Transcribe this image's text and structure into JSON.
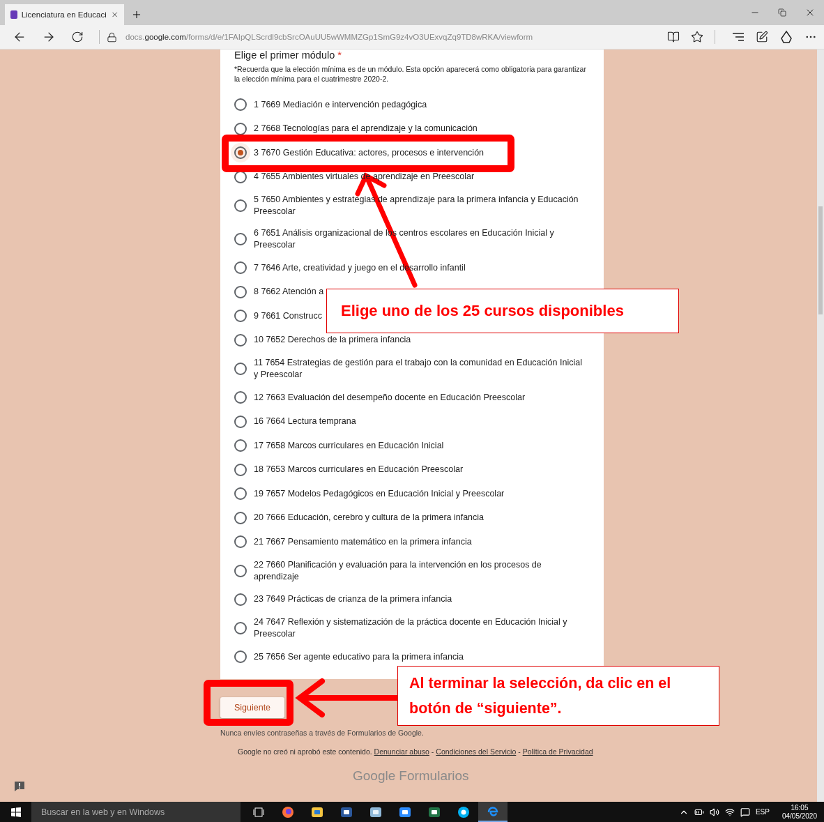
{
  "browser": {
    "tab": {
      "title": "Licenciatura en Educaci"
    },
    "url": {
      "start": "docs.",
      "host": "google.com",
      "path": "/forms/d/e/1FAIpQLScrdl9cbSrcOAuUU5wWMMZGp1SmG9z4vO3UExvqZq9TD8wRKA/viewform"
    }
  },
  "form": {
    "question": {
      "title": "Elige el primer módulo",
      "required_mark": "*",
      "description": "*Recuerda que la elección mínima es de un módulo. Esta opción aparecerá como obligatoria para garantizar la elección mínima para el cuatrimestre 2020-2.",
      "options": [
        {
          "label": "1 7669 Mediación e intervención pedagógica",
          "selected": false
        },
        {
          "label": "2 7668 Tecnologías para el aprendizaje y la comunicación",
          "selected": false
        },
        {
          "label": "3 7670 Gestión Educativa: actores, procesos e intervención",
          "selected": true
        },
        {
          "label": "4 7655 Ambientes virtuales de aprendizaje en Preescolar",
          "selected": false
        },
        {
          "label": "5 7650 Ambientes y estrategias de aprendizaje para la primera infancia y Educación Preescolar",
          "selected": false
        },
        {
          "label": "6 7651 Análisis organizacional de los centros escolares en Educación Inicial y Preescolar",
          "selected": false
        },
        {
          "label": "7 7646 Arte, creatividad y juego en el desarrollo infantil",
          "selected": false
        },
        {
          "label": "8 7662 Atención a",
          "selected": false
        },
        {
          "label": "9 7661 Construcc",
          "selected": false
        },
        {
          "label": "10 7652 Derechos de la primera infancia",
          "selected": false
        },
        {
          "label": "11 7654 Estrategias de gestión para el trabajo con la comunidad en Educación Inicial y Preescolar",
          "selected": false
        },
        {
          "label": "12 7663 Evaluación del desempeño docente en Educación Preescolar",
          "selected": false
        },
        {
          "label": "16 7664 Lectura temprana",
          "selected": false
        },
        {
          "label": "17 7658 Marcos curriculares en Educación Inicial",
          "selected": false
        },
        {
          "label": "18 7653 Marcos curriculares en Educación Preescolar",
          "selected": false
        },
        {
          "label": "19 7657 Modelos Pedagógicos en Educación Inicial y Preescolar",
          "selected": false
        },
        {
          "label": "20 7666 Educación, cerebro y cultura de la primera infancia",
          "selected": false
        },
        {
          "label": "21 7667 Pensamiento matemático en la primera infancia",
          "selected": false
        },
        {
          "label": "22 7660 Planificación y evaluación para la intervención en los procesos de aprendizaje",
          "selected": false
        },
        {
          "label": "23 7649 Prácticas de crianza de la primera infancia",
          "selected": false
        },
        {
          "label": "24 7647 Reflexión y sistematización de la práctica docente en Educación Inicial y Preescolar",
          "selected": false
        },
        {
          "label": "25 7656 Ser agente educativo para la primera infancia",
          "selected": false
        }
      ]
    },
    "next_button": "Siguiente",
    "footer": {
      "warning": "Nunca envíes contraseñas a través de Formularios de Google.",
      "notice": "Google no creó ni aprobó este contenido.",
      "separator": "-",
      "links": [
        "Denunciar abuso",
        "Condiciones del Servicio",
        "Política de Privacidad"
      ],
      "brand": [
        "Google",
        "Formularios"
      ]
    }
  },
  "callouts": [
    "Elige uno de los 25 cursos disponibles",
    "Al terminar la selección,  da clic en el botón de “siguiente”."
  ],
  "taskbar": {
    "search": {
      "placeholder": "Buscar en la web y en Windows"
    },
    "language": "ESP",
    "time": "16:05",
    "date": "04/05/2020"
  }
}
